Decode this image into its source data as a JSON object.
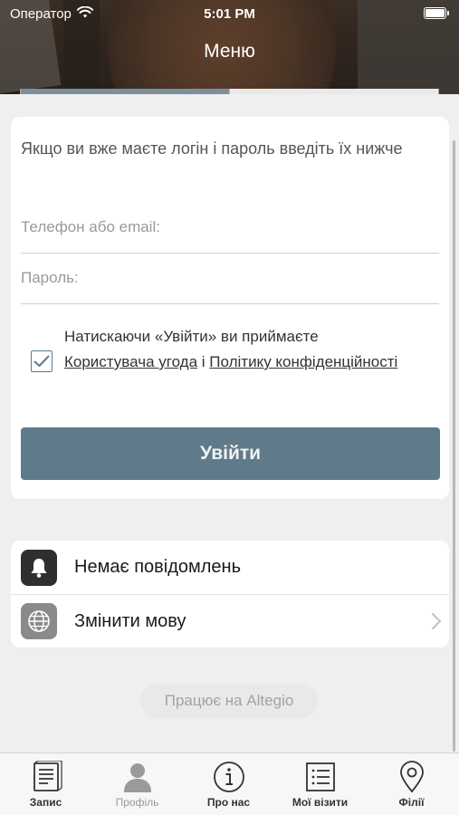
{
  "status_bar": {
    "carrier": "Оператор",
    "time": "5:01 PM"
  },
  "nav": {
    "title": "Меню"
  },
  "login": {
    "intro": "Якщо ви вже маєте логін і пароль введіть їх нижче",
    "phone_placeholder": "Телефон або email:",
    "password_placeholder": "Пароль:",
    "consent_prefix": "Натискаючи «Увійти» ви приймаєте",
    "terms_link": "Користувача угода",
    "consent_and": "і",
    "privacy_link": "Політику конфіденційності",
    "consent_checked": true,
    "submit_label": "Увійти"
  },
  "menu_list": {
    "items": [
      {
        "label": "Немає повідомлень",
        "icon": "bell-icon"
      },
      {
        "label": "Змінити мову",
        "icon": "globe-icon"
      }
    ]
  },
  "powered_by": "Працює на Altegio",
  "tabbar": {
    "items": [
      {
        "label": "Запис",
        "icon": "document-icon",
        "enabled": true
      },
      {
        "label": "Профіль",
        "icon": "person-icon",
        "enabled": false
      },
      {
        "label": "Про нас",
        "icon": "info-icon",
        "enabled": true
      },
      {
        "label": "Мої візити",
        "icon": "list-icon",
        "enabled": true
      },
      {
        "label": "Філії",
        "icon": "location-pin-icon",
        "enabled": true
      }
    ]
  },
  "colors": {
    "accent": "#5f7a89",
    "background": "#efefef",
    "card": "#ffffff"
  }
}
